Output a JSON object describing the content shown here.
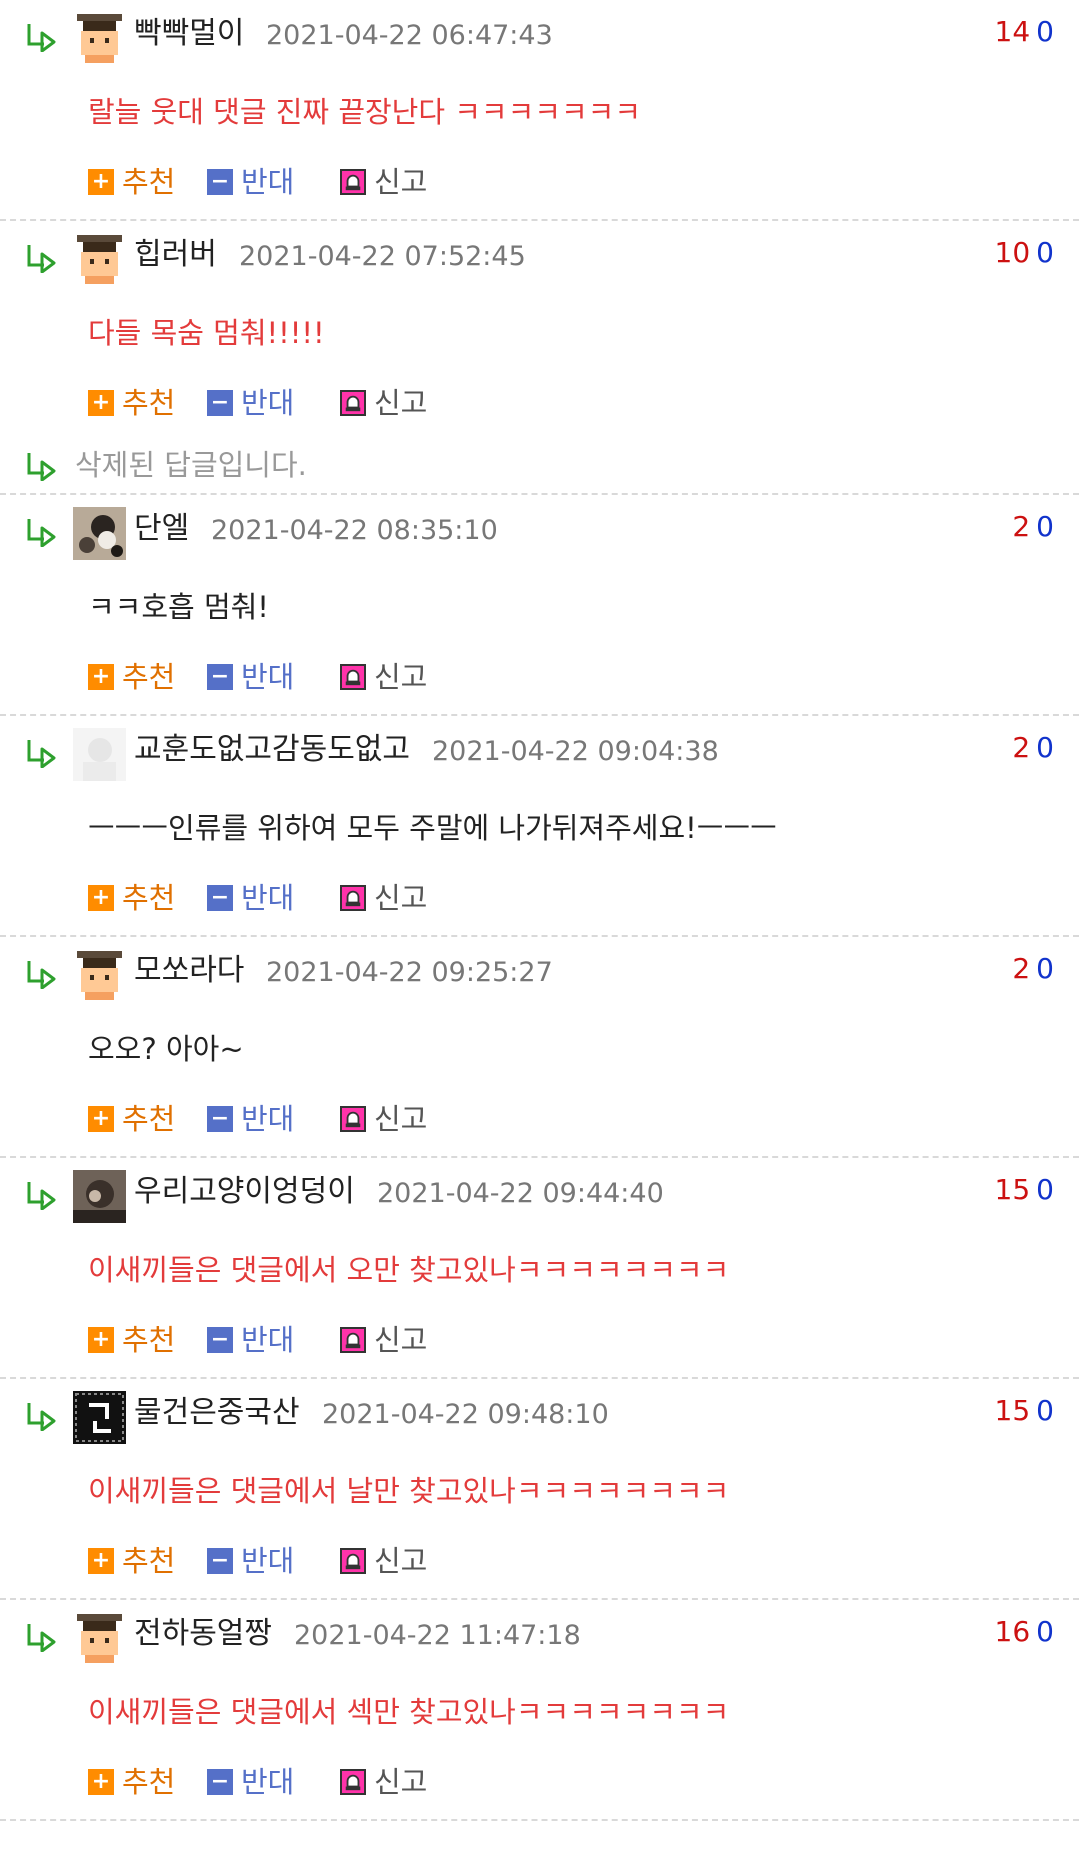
{
  "labels": {
    "upvote": "추천",
    "downvote": "반대",
    "report": "신고"
  },
  "deleted_text": "삭제된 답글입니다.",
  "comments": [
    {
      "username": "빡빡멀이",
      "timestamp": "2021-04-22 06:47:43",
      "up": "14",
      "down": "0",
      "content": "랄늘 웃대 댓글 진짜 끝장난다 ㅋㅋㅋㅋㅋㅋㅋ",
      "content_color": "red",
      "avatar": "default"
    },
    {
      "username": "힙러버",
      "timestamp": "2021-04-22 07:52:45",
      "up": "10",
      "down": "0",
      "content": "다들 목숨 멈춰!!!!!",
      "content_color": "red",
      "avatar": "default"
    },
    {
      "username": "단엘",
      "timestamp": "2021-04-22 08:35:10",
      "up": "2",
      "down": "0",
      "content": "ㅋㅋ호흡 멈춰!",
      "content_color": "black",
      "avatar": "photo-cat"
    },
    {
      "username": "교훈도없고감동도없고",
      "timestamp": "2021-04-22 09:04:38",
      "up": "2",
      "down": "0",
      "content": "ㅡㅡㅡ인류를 위하여 모두 주말에 나가뒤져주세요!ㅡㅡㅡ",
      "content_color": "black",
      "avatar": "photo-faded"
    },
    {
      "username": "모쏘라다",
      "timestamp": "2021-04-22 09:25:27",
      "up": "2",
      "down": "0",
      "content": "오오? 아아~",
      "content_color": "black",
      "avatar": "default"
    },
    {
      "username": "우리고양이엉덩이",
      "timestamp": "2021-04-22 09:44:40",
      "up": "15",
      "down": "0",
      "content": "이새끼들은 댓글에서 오만 찾고있나ㅋㅋㅋㅋㅋㅋㅋㅋ",
      "content_color": "red",
      "avatar": "photo-dark"
    },
    {
      "username": "물건은중국산",
      "timestamp": "2021-04-22 09:48:10",
      "up": "15",
      "down": "0",
      "content": "이새끼들은 댓글에서 날만 찾고있나ㅋㅋㅋㅋㅋㅋㅋㅋ",
      "content_color": "red",
      "avatar": "black-tile"
    },
    {
      "username": "전하동얼짱",
      "timestamp": "2021-04-22 11:47:18",
      "up": "16",
      "down": "0",
      "content": "이새끼들은 댓글에서 섹만 찾고있나ㅋㅋㅋㅋㅋㅋㅋㅋ",
      "content_color": "red",
      "avatar": "default"
    }
  ],
  "colors": {
    "upvote_count": "#cc1111",
    "downvote_count": "#1133cc",
    "reply_arrow": "#2ea02e",
    "content_red": "#e33b3b"
  }
}
